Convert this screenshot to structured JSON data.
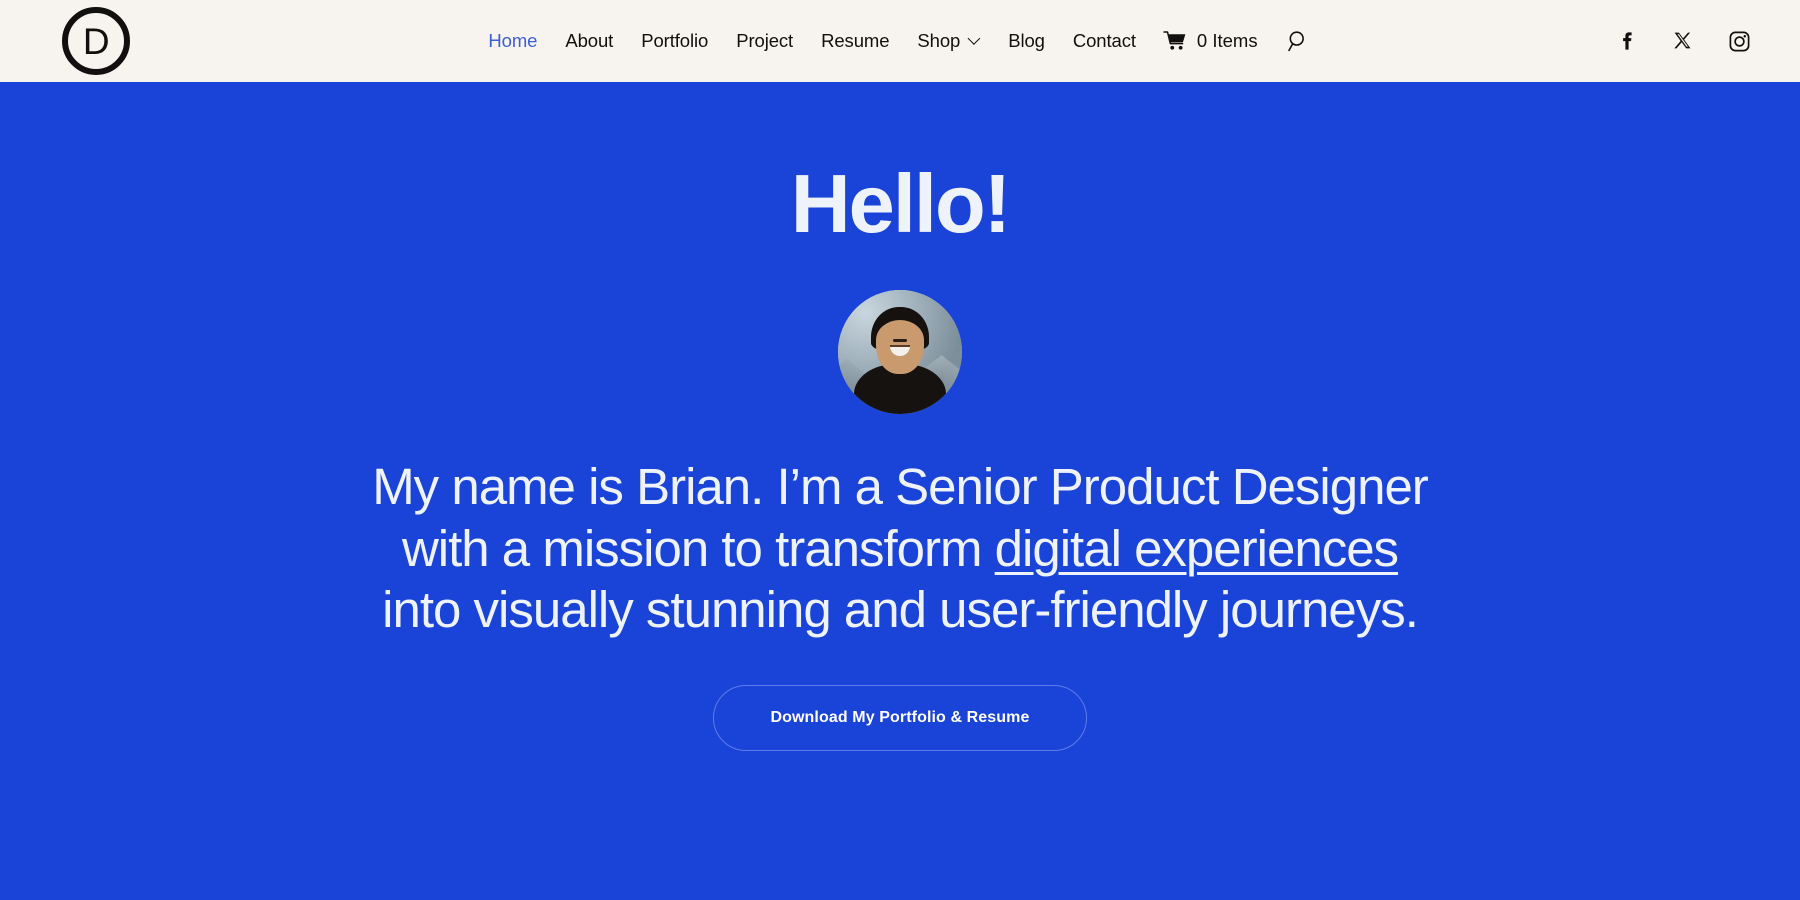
{
  "colors": {
    "header_bg": "#f7f4f0",
    "hero_bg": "#1a43d8",
    "accent_blue": "#3b5fd4",
    "text_dark": "#11100e",
    "text_light": "#eef2fb",
    "button_border": "#5d7ce9"
  },
  "header": {
    "logo_letter": "D",
    "nav": [
      {
        "label": "Home",
        "active": true,
        "has_submenu": false
      },
      {
        "label": "About",
        "active": false,
        "has_submenu": false
      },
      {
        "label": "Portfolio",
        "active": false,
        "has_submenu": false
      },
      {
        "label": "Project",
        "active": false,
        "has_submenu": false
      },
      {
        "label": "Resume",
        "active": false,
        "has_submenu": false
      },
      {
        "label": "Shop",
        "active": false,
        "has_submenu": true
      },
      {
        "label": "Blog",
        "active": false,
        "has_submenu": false
      },
      {
        "label": "Contact",
        "active": false,
        "has_submenu": false
      }
    ],
    "cart": {
      "count_label": "0 Items",
      "icon": "shopping-cart-icon"
    },
    "search": {
      "icon": "search-icon"
    },
    "socials": [
      {
        "name": "facebook-icon",
        "label": "Facebook"
      },
      {
        "name": "x-twitter-icon",
        "label": "X"
      },
      {
        "name": "instagram-icon",
        "label": "Instagram"
      }
    ]
  },
  "hero": {
    "heading": "Hello!",
    "avatar_alt": "Portrait of Brian smiling in front of mountains",
    "tagline": {
      "part1": "My name is Brian. I’m a Senior Product Designer with a mission to transform ",
      "link": "digital experiences",
      "part2": " into visually stunning and user-friendly journeys."
    },
    "cta_label": "Download My Portfolio & Resume"
  }
}
